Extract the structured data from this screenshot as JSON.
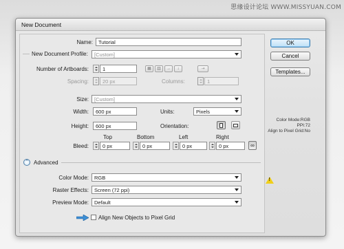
{
  "watermark": "思缘设计论坛 WWW.MISSYUAN.COM",
  "window": {
    "title": "New Document"
  },
  "name": {
    "label": "Name:",
    "value": "Tutorial"
  },
  "profile": {
    "label": "New Document Profile:",
    "value": "[Custom]"
  },
  "artboards": {
    "label": "Number of Artboards:",
    "value": "1",
    "spacing_label": "Spacing:",
    "spacing_value": "20 px",
    "columns_label": "Columns:",
    "columns_value": "1",
    "arrange_icons": [
      "grid-by-row-icon",
      "grid-by-column-icon",
      "arrange-by-row-icon",
      "arrange-by-column-icon",
      "right-to-left-icon"
    ]
  },
  "size": {
    "label": "Size:",
    "value": "[Custom]"
  },
  "width": {
    "label": "Width:",
    "value": "600 px"
  },
  "units": {
    "label": "Units:",
    "value": "Pixels"
  },
  "height": {
    "label": "Height:",
    "value": "600 px"
  },
  "orientation": {
    "label": "Orientation:",
    "selected": "portrait"
  },
  "bleed": {
    "label": "Bleed:",
    "top_label": "Top",
    "top": "0 px",
    "bottom_label": "Bottom",
    "bottom": "0 px",
    "left_label": "Left",
    "left": "0 px",
    "right_label": "Right",
    "right": "0 px",
    "linked": true
  },
  "advanced": {
    "label": "Advanced",
    "color_mode_label": "Color Mode:",
    "color_mode": "RGB",
    "raster_label": "Raster Effects:",
    "raster": "Screen (72 ppi)",
    "preview_label": "Preview Mode:",
    "preview": "Default",
    "align_label": "Align New Objects to Pixel Grid",
    "align_checked": false
  },
  "buttons": {
    "ok": "OK",
    "cancel": "Cancel",
    "templates": "Templates..."
  },
  "summary": {
    "color_mode": "Color Mode:RGB",
    "ppi": "PPI:72",
    "align": "Align to Pixel Grid:No"
  },
  "colors": {
    "accent": "#3c7fb1",
    "warning": "#f0cf1a",
    "pointer": "#3d8fd6"
  }
}
